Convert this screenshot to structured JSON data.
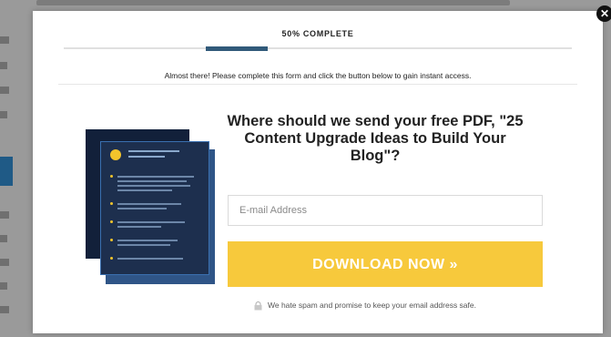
{
  "modal": {
    "progress_label": "50% COMPLETE",
    "progress_value": 0.5,
    "notice": "Almost there! Please complete this form and click the button below to gain instant access.",
    "headline": "Where should we send your free PDF, \"25 Content Upgrade Ideas to Build Your Blog\"?",
    "email_placeholder": "E-mail Address",
    "download_label": "DOWNLOAD NOW »",
    "spam_note": "We hate spam and promise to keep your email address safe.",
    "close_icon": "close-icon",
    "lock_icon": "lock-icon"
  },
  "colors": {
    "progress_fill": "#315a7a",
    "button": "#f7c93c",
    "ebook": "#1d2f4e"
  }
}
